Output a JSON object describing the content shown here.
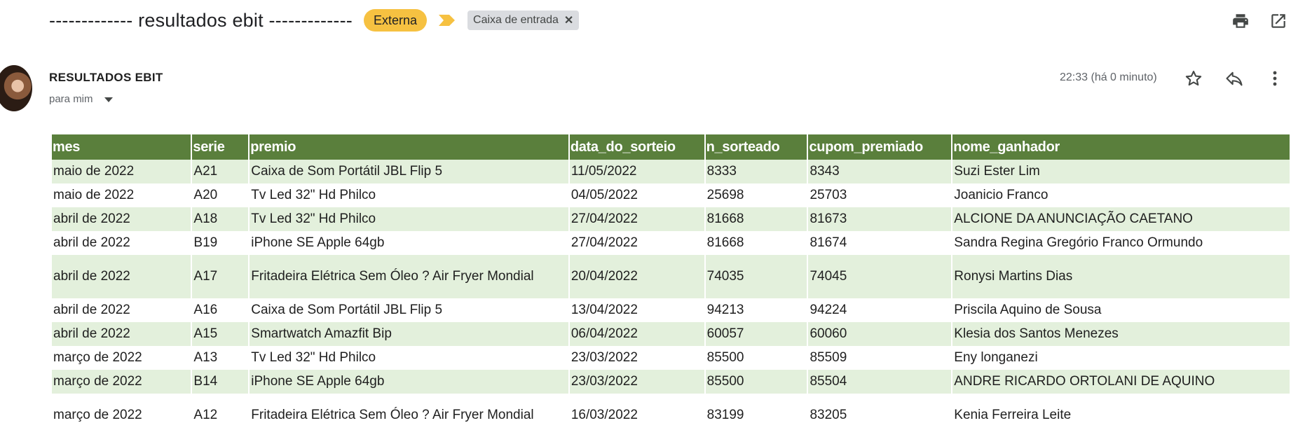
{
  "subject": "------------- resultados ebit -------------",
  "badges": {
    "externa": "Externa",
    "label": "Caixa de entrada",
    "label_close": "✕"
  },
  "icons": {
    "print": "printer-icon",
    "open_new": "open-in-new-window-icon",
    "star": "star-icon",
    "reply": "reply-icon",
    "more": "more-vert-icon",
    "important": "important-marker-icon",
    "caret": "chevron-down-icon"
  },
  "colors": {
    "externa_badge": "#f6c141",
    "important_marker": "#f6c141",
    "table_header": "#5a7f3c",
    "table_alt_row": "#e3f0dc"
  },
  "sender": {
    "name": "RESULTADOS EBIT",
    "recipient": "para mim",
    "timestamp": "22:33 (há 0 minuto)"
  },
  "table": {
    "headers": [
      "mes",
      "serie",
      "premio",
      "data_do_sorteio",
      "n_sorteado",
      "cupom_premiado",
      "nome_ganhador"
    ],
    "rows": [
      [
        "maio de 2022",
        "A21",
        "Caixa de Som Portátil JBL Flip 5",
        "11/05/2022",
        "8333",
        "8343",
        "Suzi Ester Lim"
      ],
      [
        "maio de 2022",
        "A20",
        "Tv Led 32\" Hd Philco",
        "04/05/2022",
        "25698",
        "25703",
        "Joanicio Franco"
      ],
      [
        "abril de 2022",
        "A18",
        "Tv Led 32\" Hd Philco",
        "27/04/2022",
        "81668",
        "81673",
        "ALCIONE DA ANUNCIAÇÃO CAETANO"
      ],
      [
        "abril de 2022",
        "B19",
        "iPhone SE Apple 64gb",
        "27/04/2022",
        "81668",
        "81674",
        "Sandra Regina Gregório Franco Ormundo"
      ],
      [
        "abril de 2022",
        "A17",
        "Fritadeira Elétrica Sem Óleo ? Air Fryer Mondial",
        "20/04/2022",
        "74035",
        "74045",
        "Ronysi Martins Dias"
      ],
      [
        "abril de 2022",
        "A16",
        "Caixa de Som Portátil JBL Flip 5",
        "13/04/2022",
        "94213",
        "94224",
        "Priscila Aquino de Sousa"
      ],
      [
        "abril de 2022",
        "A15",
        "Smartwatch Amazfit Bip",
        "06/04/2022",
        "60057",
        "60060",
        "Klesia dos Santos Menezes"
      ],
      [
        "março de 2022",
        "A13",
        "Tv Led 32\" Hd Philco",
        "23/03/2022",
        "85500",
        "85509",
        "Eny longanezi"
      ],
      [
        "março de 2022",
        "B14",
        "iPhone SE Apple 64gb",
        "23/03/2022",
        "85500",
        "85504",
        "ANDRE RICARDO ORTOLANI DE AQUINO"
      ],
      [
        "março de 2022",
        "A12",
        "Fritadeira Elétrica Sem Óleo ? Air Fryer Mondial",
        "16/03/2022",
        "83199",
        "83205",
        "Kenia Ferreira Leite"
      ]
    ]
  }
}
